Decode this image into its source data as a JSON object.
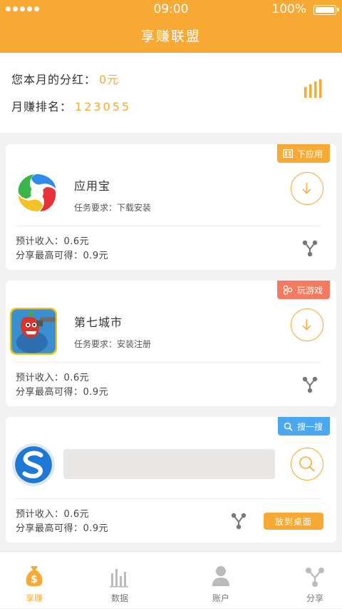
{
  "status_bar": {
    "time": "09:00",
    "battery": "100%"
  },
  "header": {
    "title": "享赚联盟"
  },
  "summary": {
    "dividend_label": "您本月的分红：",
    "dividend_value": "0元",
    "rank_label": "月赚排名：",
    "rank_value": "123055"
  },
  "cards": [
    {
      "badge": "下应用",
      "name": "应用宝",
      "task": "任务要求：下载安装",
      "income": "预计收入：0.6元",
      "share_max": "分享最高可得：0.9元"
    },
    {
      "badge": "玩游戏",
      "name": "第七城市",
      "task": "任务要求：安装注册",
      "income": "预计收入：0.6元",
      "share_max": "分享最高可得：0.9元"
    },
    {
      "badge": "搜一搜",
      "income": "预计收入：0.6元",
      "share_max": "分享最高可得：0.9元",
      "action_button": "放到桌面"
    }
  ],
  "tabbar": [
    {
      "label": "享赚",
      "icon": "money-bag-icon",
      "active": true
    },
    {
      "label": "数据",
      "icon": "bar-chart-icon",
      "active": false
    },
    {
      "label": "账户",
      "icon": "person-icon",
      "active": false
    },
    {
      "label": "分享",
      "icon": "share-icon",
      "active": false
    }
  ],
  "colors": {
    "accent": "#f7a934",
    "game": "#f47b61",
    "search": "#4aa7f0"
  }
}
